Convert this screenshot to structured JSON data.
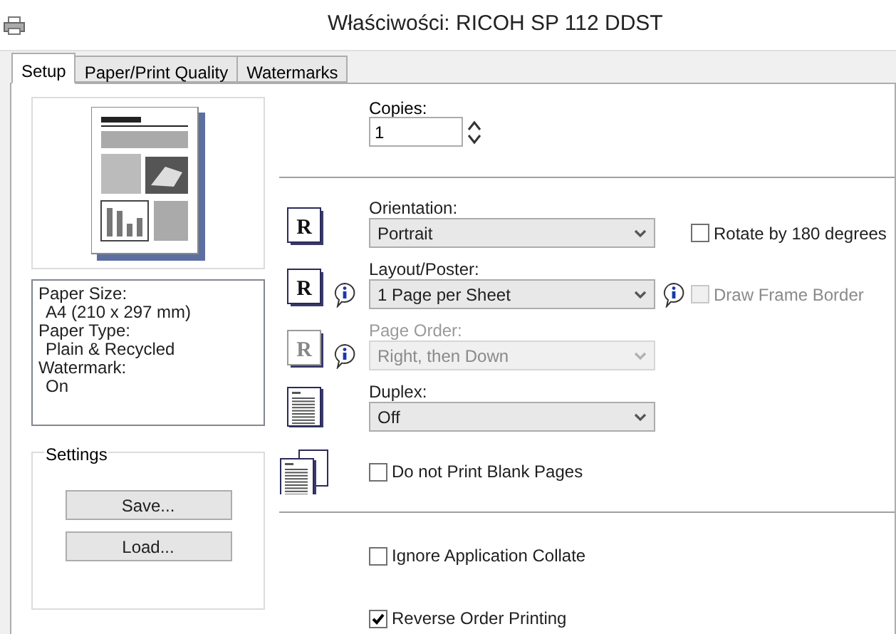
{
  "window": {
    "title": "Właściwości: RICOH SP 112 DDST"
  },
  "tabs": [
    {
      "label": "Setup",
      "selected": true
    },
    {
      "label": "Paper/Print Quality",
      "selected": false
    },
    {
      "label": "Watermarks",
      "selected": false
    }
  ],
  "info": [
    {
      "label": "Paper Size:",
      "value": "A4 (210 x 297 mm)"
    },
    {
      "label": "Paper Type:",
      "value": "Plain & Recycled"
    },
    {
      "label": "Watermark:",
      "value": "On"
    }
  ],
  "settings": {
    "title": "Settings",
    "buttons": [
      "Save...",
      "Load..."
    ]
  },
  "copies": {
    "label": "Copies:",
    "value": "1"
  },
  "fields": [
    {
      "kind": "orientation",
      "icon_letter": "R",
      "label": "Orientation:",
      "value": "Portrait",
      "disabled": false,
      "info": false,
      "extra": {
        "label": "Rotate by 180 degrees",
        "checked": false,
        "disabled": false,
        "info": false
      }
    },
    {
      "kind": "layout",
      "icon_letter": "R",
      "label": "Layout/Poster:",
      "value": "1 Page per Sheet",
      "disabled": false,
      "info": true,
      "extra": {
        "label": "Draw Frame Border",
        "checked": false,
        "disabled": true,
        "info": true
      }
    },
    {
      "kind": "order",
      "icon_letter": "R",
      "label": "Page Order:",
      "value": "Right, then Down",
      "disabled": true,
      "info": true
    },
    {
      "kind": "duplex",
      "label": "Duplex:",
      "value": "Off",
      "disabled": false,
      "info": false
    }
  ],
  "blank_pages": {
    "label": "Do not Print Blank Pages",
    "checked": false,
    "disabled": false
  },
  "options": [
    {
      "label": "Ignore Application Collate",
      "checked": false,
      "disabled": false
    },
    {
      "label": "Reverse Order Printing",
      "checked": true,
      "disabled": false
    }
  ]
}
